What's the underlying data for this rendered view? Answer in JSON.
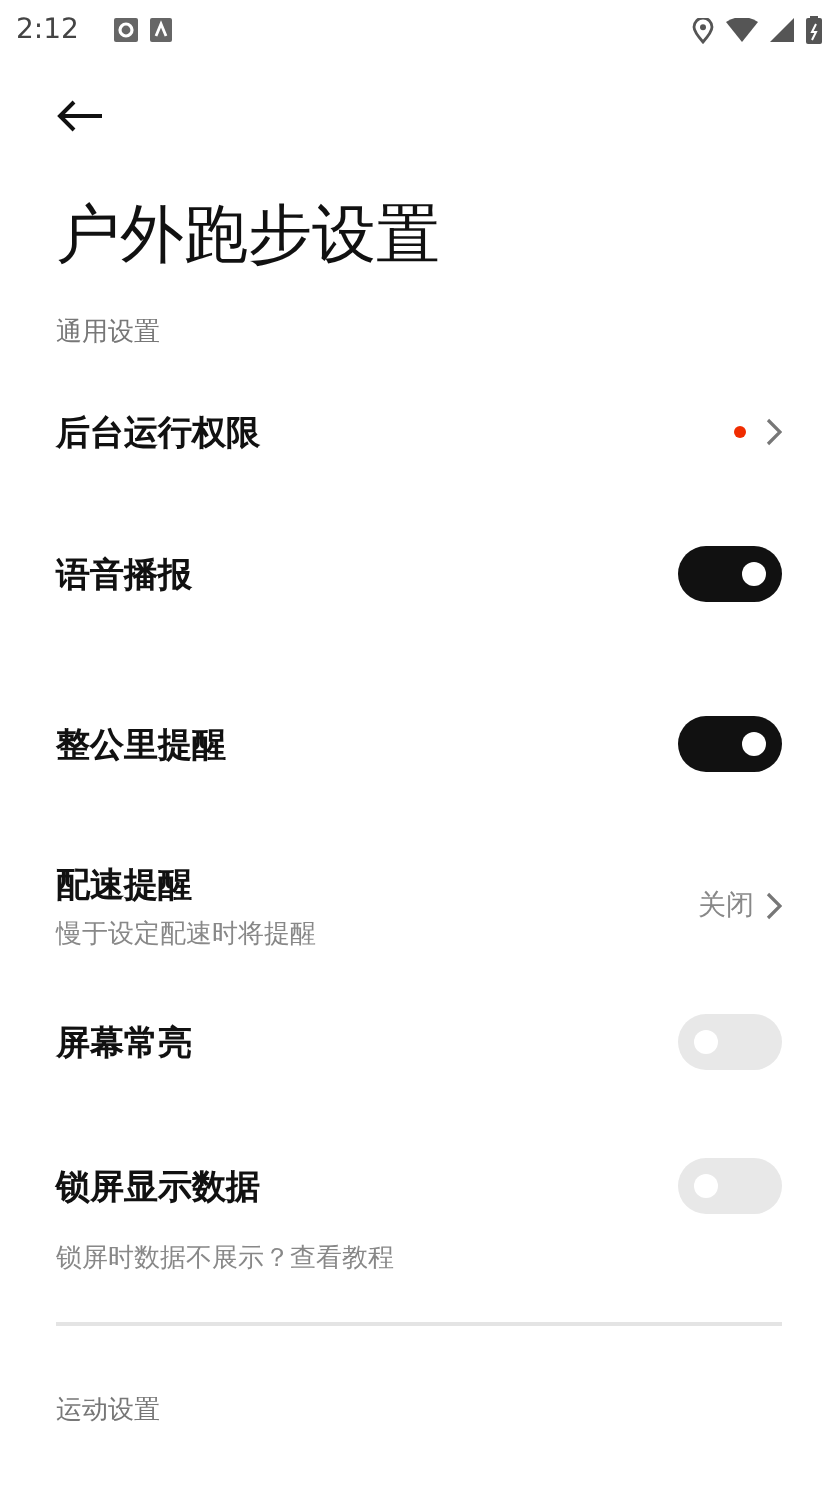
{
  "status_bar": {
    "time": "2:12"
  },
  "title": "户外跑步设置",
  "sections": [
    {
      "header": "通用设置",
      "rows": [
        {
          "kind": "link",
          "label": "后台运行权限",
          "alert": true,
          "color": "#f02c00"
        },
        {
          "kind": "toggle",
          "label": "语音播报",
          "on": true
        },
        {
          "kind": "toggle",
          "label": "整公里提醒",
          "on": true
        },
        {
          "kind": "link",
          "label": "配速提醒",
          "subtitle": "慢于设定配速时将提醒",
          "value": "关闭",
          "alert": false
        },
        {
          "kind": "toggle",
          "label": "屏幕常亮",
          "on": false
        },
        {
          "kind": "toggle",
          "label": "锁屏显示数据",
          "on": false
        }
      ],
      "note": {
        "text": "锁屏时数据不展示？",
        "link": "查看教程"
      }
    },
    {
      "header": "运动设置"
    }
  ]
}
